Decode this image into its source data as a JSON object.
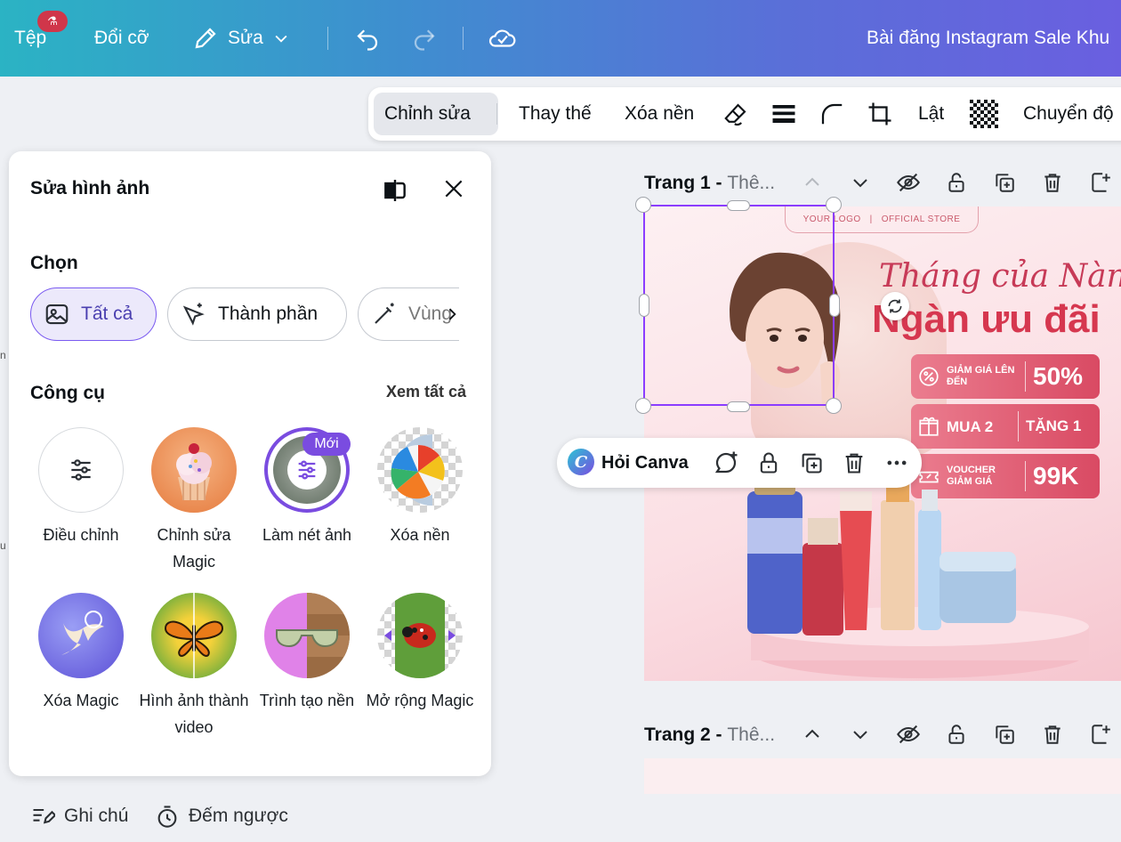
{
  "topbar": {
    "file_label": "Tệp",
    "resize_label": "Đổi cỡ",
    "edit_label": "Sửa",
    "title": "Bài đăng Instagram Sale Khu"
  },
  "context_toolbar": {
    "edit": "Chỉnh sửa",
    "replace": "Thay thế",
    "remove_bg": "Xóa nền",
    "flip": "Lật",
    "transform": "Chuyển độ"
  },
  "panel": {
    "title": "Sửa hình ảnh",
    "select_label": "Chọn",
    "chips": [
      {
        "label": "Tất cả",
        "active": true
      },
      {
        "label": "Thành phần",
        "active": false
      },
      {
        "label": "Vùng",
        "active": false
      }
    ],
    "tools_label": "Công cụ",
    "see_all": "Xem tất cả",
    "new_badge": "Mới",
    "tools": [
      {
        "label": "Điều chỉnh"
      },
      {
        "label": "Chỉnh sửa Magic"
      },
      {
        "label": "Làm nét ảnh"
      },
      {
        "label": "Xóa nền"
      },
      {
        "label": "Xóa Magic"
      },
      {
        "label": "Hình ảnh thành video"
      },
      {
        "label": "Trình tạo nền"
      },
      {
        "label": "Mở rộng Magic"
      }
    ]
  },
  "bottom": {
    "notes": "Ghi chú",
    "timer": "Đếm ngược"
  },
  "pages": [
    {
      "label": "Trang 1 - ",
      "sub": "Thê..."
    },
    {
      "label": "Trang 2 - ",
      "sub": "Thê..."
    }
  ],
  "design": {
    "logo": "YOUR LOGO",
    "store": "OFFICIAL STORE",
    "script_title": "Tháng của Nàng",
    "big_title": "Ngàn ưu đãi",
    "offers": [
      {
        "small": "GIẢM GIÁ LÊN ĐẾN",
        "big": "50%"
      },
      {
        "small": "MUA 2",
        "big": "TẶNG 1"
      },
      {
        "small": "VOUCHER GIẢM GIÁ",
        "big": "99K"
      }
    ]
  },
  "ask_bar": {
    "label": "Hỏi Canva"
  },
  "colors": {
    "accent": "#8b3dff",
    "sale_pink": "#d94a63"
  }
}
